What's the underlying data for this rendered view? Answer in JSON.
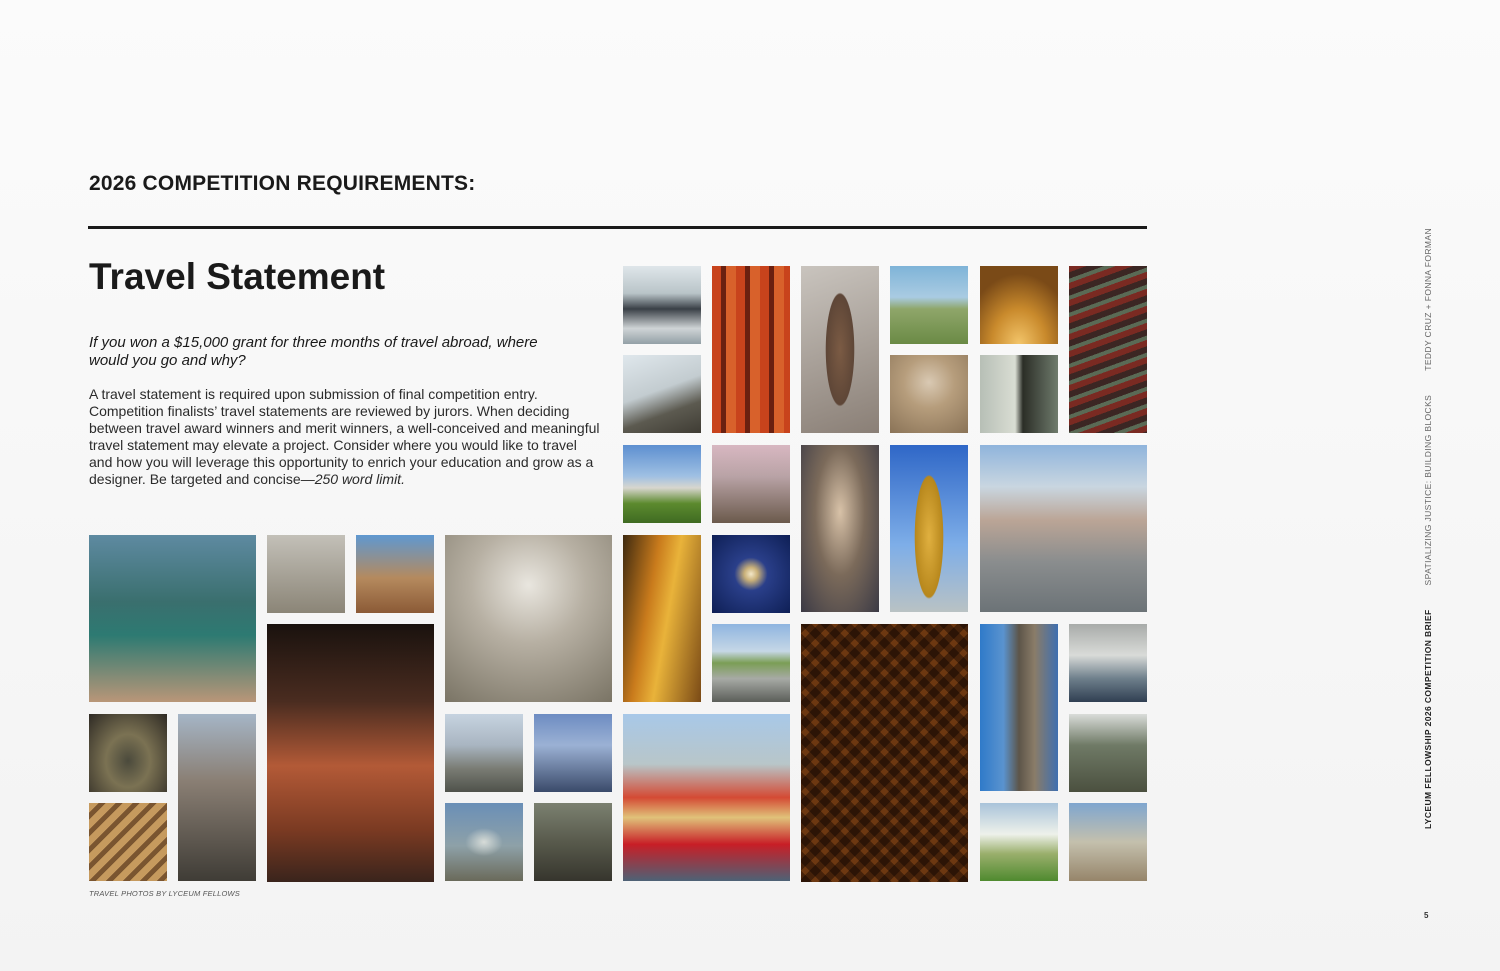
{
  "section_title": "2026 COMPETITION REQUIREMENTS:",
  "heading": "Travel Statement",
  "question": "If you won a $15,000 grant for three months of travel abroad, where would you go and why?",
  "body": "A travel statement is required upon submission of final competition entry. Competition finalists’ travel statements are reviewed by jurors. When deciding between travel award winners and merit winners, a well-conceived and meaningful travel statement may elevate a project. Consider where you would like to travel and how you will leverage this opportunity to enrich your education and grow as a designer. Be targeted and concise—",
  "body_limit": "250 word limit.",
  "caption": "TRAVEL PHOTOS BY LYCEUM FELLOWS",
  "sidebar": {
    "brief": "LYCEUM FELLOWSHIP 2026 COMPETITION BRIEF",
    "theme": "SPATIALIZING JUSTICE: BUILDING BLOCKS",
    "authors": "TEDDY CRUZ + FONNA FORMAN"
  },
  "page_number": "5"
}
